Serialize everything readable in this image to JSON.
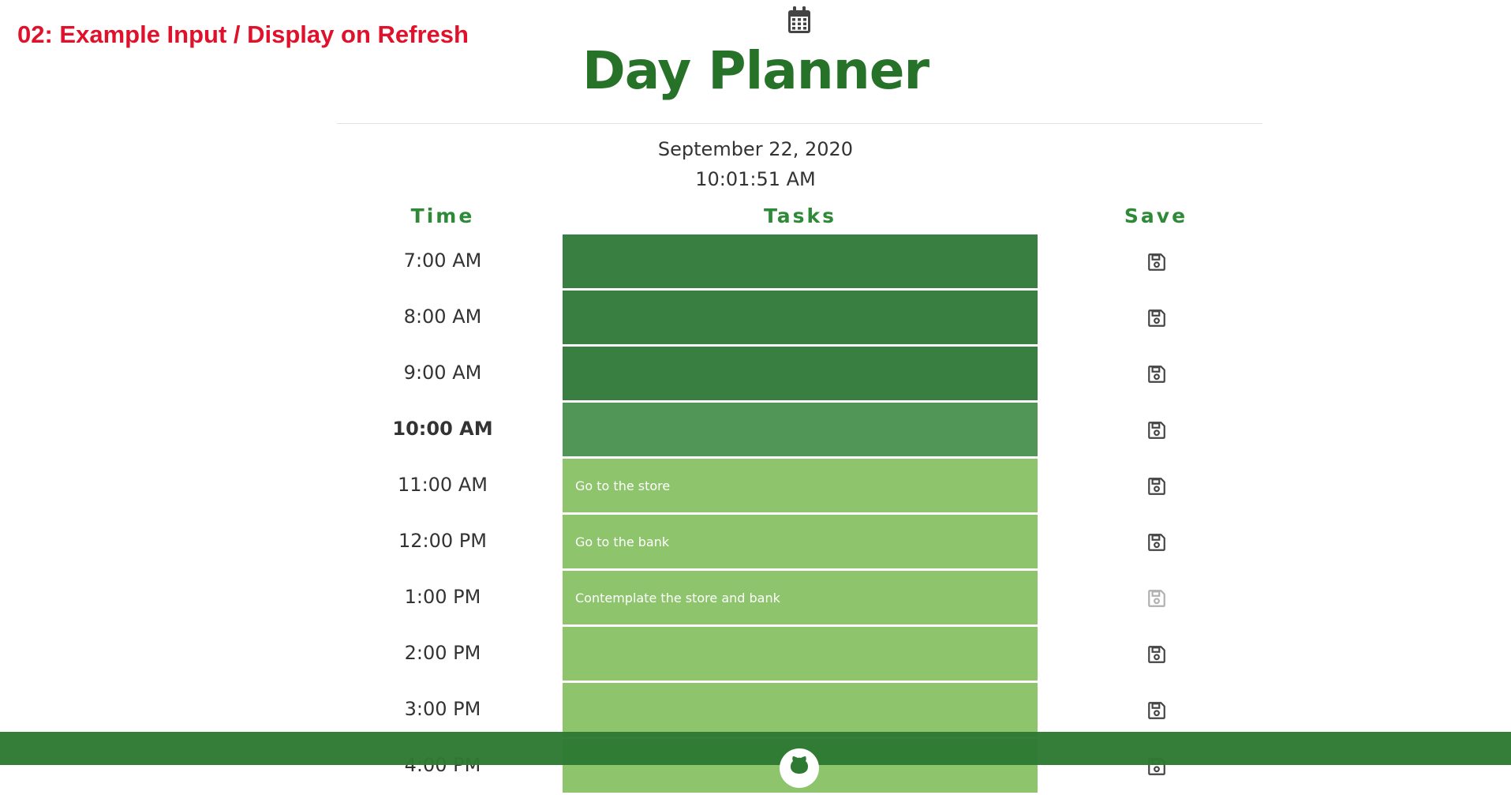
{
  "caption": "02: Example Input / Display on Refresh",
  "header": {
    "title": "Day Planner",
    "icon": "calendar-icon"
  },
  "date": "September 22, 2020",
  "clock": "10:01:51 AM",
  "columns": {
    "time": "Time",
    "tasks": "Tasks",
    "save": "Save"
  },
  "rows": [
    {
      "time": "7:00 AM",
      "task": "",
      "state": "past"
    },
    {
      "time": "8:00 AM",
      "task": "",
      "state": "past"
    },
    {
      "time": "9:00 AM",
      "task": "",
      "state": "past"
    },
    {
      "time": "10:00 AM",
      "task": "",
      "state": "present"
    },
    {
      "time": "11:00 AM",
      "task": "Go to the store",
      "state": "future"
    },
    {
      "time": "12:00 PM",
      "task": "Go to the bank",
      "state": "future"
    },
    {
      "time": "1:00 PM",
      "task": "Contemplate the store and bank",
      "state": "future"
    },
    {
      "time": "2:00 PM",
      "task": "",
      "state": "future"
    },
    {
      "time": "3:00 PM",
      "task": "",
      "state": "future"
    },
    {
      "time": "4:00 PM",
      "task": "",
      "state": "future"
    }
  ],
  "colors": {
    "title": "#267228",
    "header_text": "#2f8a38",
    "past": "#387f41",
    "present": "#529657",
    "future": "#8dc46c",
    "footer": "#2e7a33",
    "caption": "#e0112b"
  },
  "footer": {
    "icon": "github-icon"
  }
}
